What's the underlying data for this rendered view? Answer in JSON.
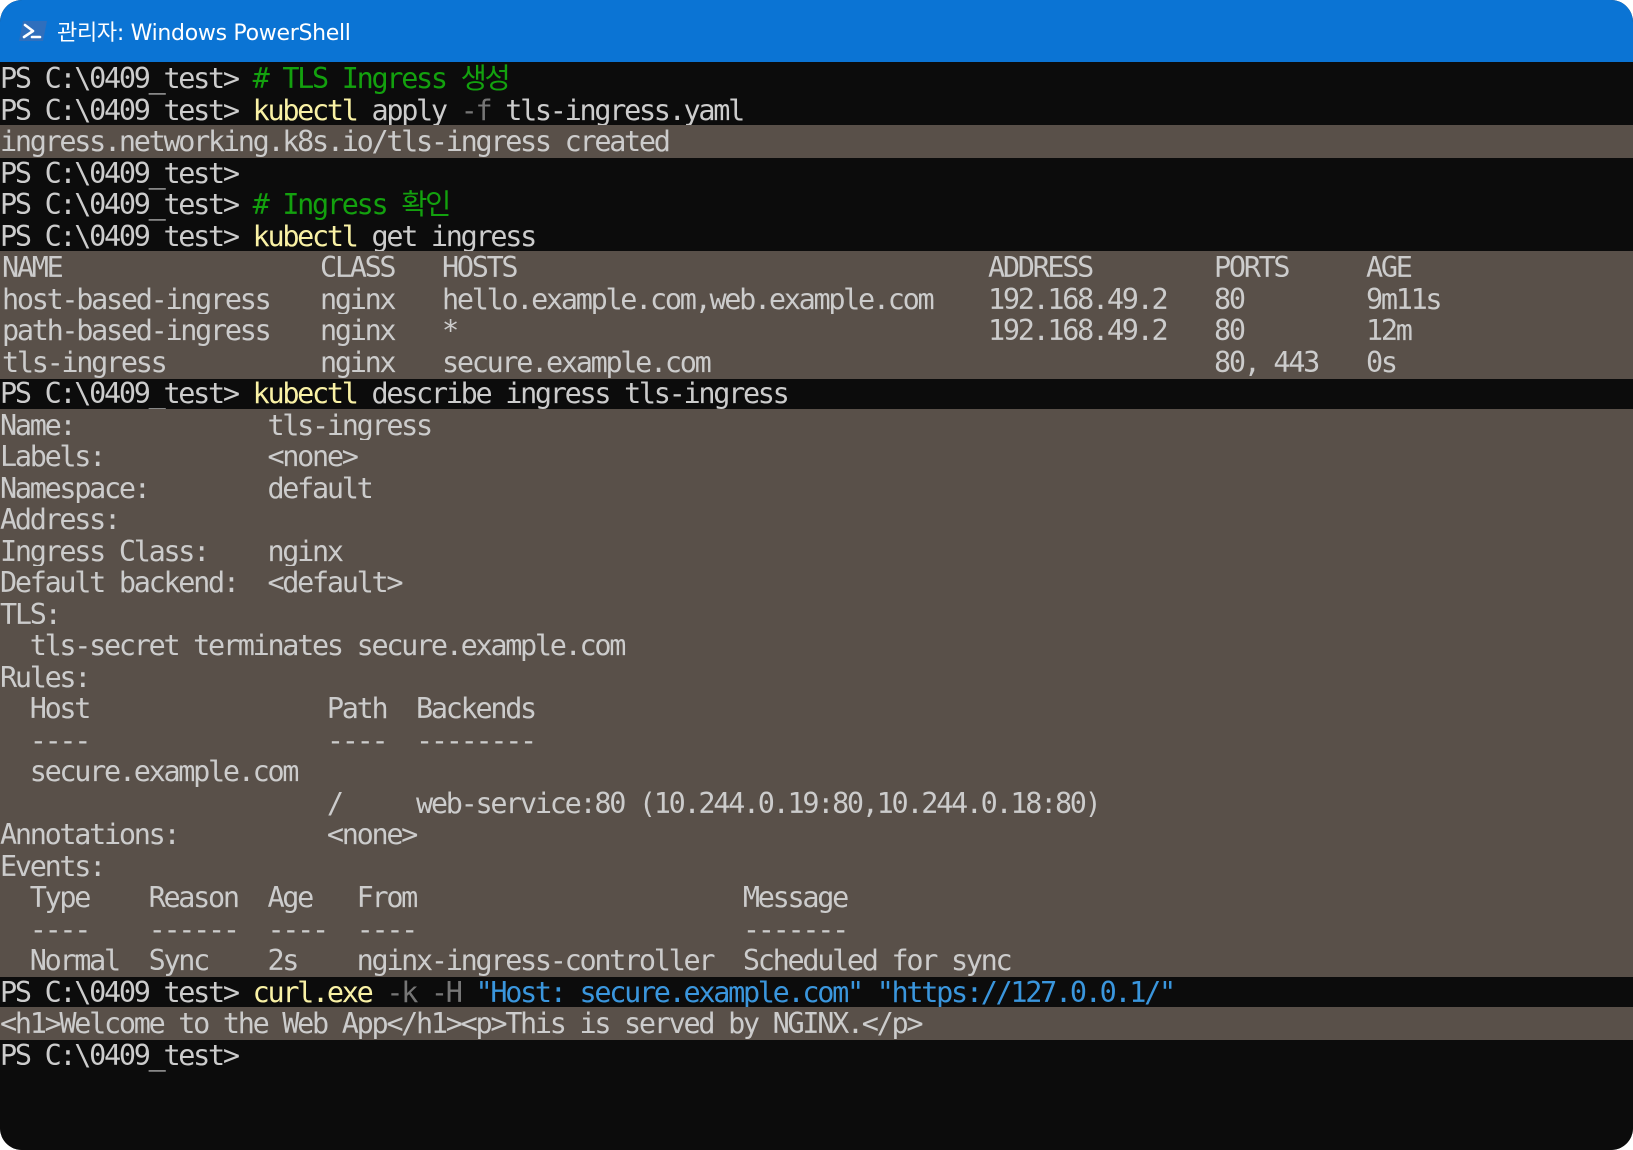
{
  "window": {
    "title": "관리자: Windows PowerShell",
    "icon": "powershell-icon",
    "titlebar_color": "#0b74d4",
    "console_bg": "#0c0c0c",
    "output_bg": "#595049"
  },
  "prompt": "PS C:\\0409_test> ",
  "lines": {
    "l1": {
      "comment": "# TLS Ingress 생성"
    },
    "l2": {
      "cmd": "kubectl",
      "args": " apply ",
      "flag": "-f",
      "rest": " tls-ingress.yaml"
    },
    "l3": {
      "text": "ingress.networking.k8s.io/tls-ingress created"
    },
    "l4": {},
    "l5": {
      "comment": "# Ingress 확인"
    },
    "l6": {
      "cmd": "kubectl",
      "args": " get ingress"
    },
    "ingress_table": {
      "headers": [
        "NAME",
        "CLASS",
        "HOSTS",
        "ADDRESS",
        "PORTS",
        "AGE"
      ],
      "rows": [
        [
          "host-based-ingress",
          "nginx",
          "hello.example.com,web.example.com",
          "192.168.49.2",
          "80",
          "9m11s"
        ],
        [
          "path-based-ingress",
          "nginx",
          "*",
          "192.168.49.2",
          "80",
          "12m"
        ],
        [
          "tls-ingress",
          "nginx",
          "secure.example.com",
          "",
          "80, 443",
          "0s"
        ]
      ]
    },
    "l11": {
      "cmd": "kubectl",
      "args": " describe ingress tls-ingress"
    },
    "describe": {
      "name": "Name:             tls-ingress",
      "labels": "Labels:           <none>",
      "namespace": "Namespace:        default",
      "address": "Address:",
      "ingress_class": "Ingress Class:    nginx",
      "default_backend": "Default backend:  <default>",
      "tls": "TLS:",
      "tls_line": "  tls-secret terminates secure.example.com",
      "rules": "Rules:",
      "rules_header": "  Host                Path  Backends",
      "rules_sep": "  ----                ----  --------",
      "rules_host": "  secure.example.com",
      "rules_path": "                      /     web-service:80 (10.244.0.19:80,10.244.0.18:80)",
      "annotations": "Annotations:          <none>",
      "events": "Events:",
      "events_header": "  Type    Reason  Age   From                      Message",
      "events_sep": "  ----    ------  ----  ----                      -------",
      "events_row": "  Normal  Sync    2s    nginx-ingress-controller  Scheduled for sync"
    },
    "l30": {
      "cmd": "curl.exe",
      "flag1": " -k -H ",
      "str1": "\"Host: secure.example.com\"",
      "sp": " ",
      "str2": "\"https://127.0.0.1/\""
    },
    "l31": {
      "text": "<h1>Welcome to the Web App</h1><p>This is served by NGINX.</p>"
    },
    "l32": {}
  }
}
